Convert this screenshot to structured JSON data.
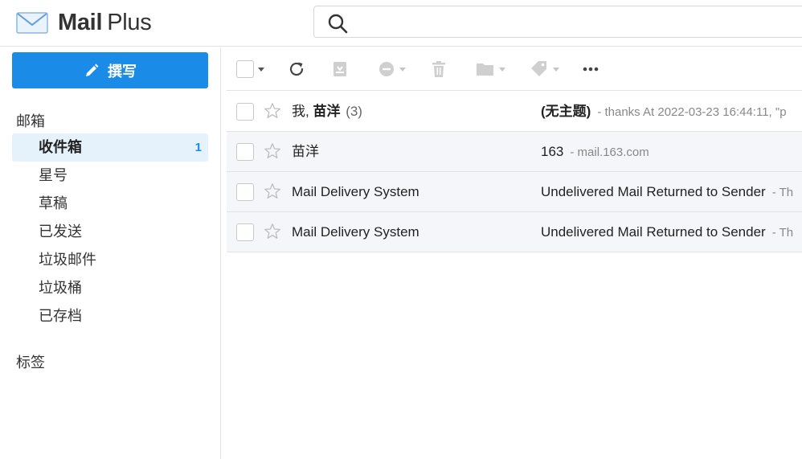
{
  "app": {
    "name_bold": "Mail",
    "name_regular": "Plus"
  },
  "search": {
    "placeholder": ""
  },
  "sidebar": {
    "compose_label": "撰写",
    "mailbox_header": "邮箱",
    "items": [
      {
        "label": "收件箱",
        "count": "1"
      },
      {
        "label": "星号",
        "count": ""
      },
      {
        "label": "草稿",
        "count": ""
      },
      {
        "label": "已发送",
        "count": ""
      },
      {
        "label": "垃圾邮件",
        "count": ""
      },
      {
        "label": "垃圾桶",
        "count": ""
      },
      {
        "label": "已存档",
        "count": ""
      }
    ],
    "labels_header": "标签"
  },
  "toolbar": {
    "icons": [
      "select-all-checkbox",
      "refresh-icon",
      "archive-icon",
      "block-icon",
      "trash-icon",
      "folder-icon",
      "tag-icon",
      "more-icon"
    ]
  },
  "mails": [
    {
      "sender_prefix": "我, ",
      "sender": "苗洋",
      "thread_count": "(3)",
      "subject": "(无主题)",
      "preview": "- thanks At 2022-03-23 16:44:11, \"p",
      "unread": true
    },
    {
      "sender_prefix": "",
      "sender": "苗洋",
      "thread_count": "",
      "subject": "163",
      "preview": "- mail.163.com",
      "unread": false
    },
    {
      "sender_prefix": "",
      "sender": "Mail Delivery System",
      "thread_count": "",
      "subject": "Undelivered Mail Returned to Sender",
      "preview": "- Th",
      "unread": false
    },
    {
      "sender_prefix": "",
      "sender": "Mail Delivery System",
      "thread_count": "",
      "subject": "Undelivered Mail Returned to Sender",
      "preview": "- Th",
      "unread": false
    }
  ],
  "colors": {
    "accent": "#1a8be6",
    "active_bg": "#e6f2fb",
    "alt_row_bg": "#f4f6f9"
  }
}
